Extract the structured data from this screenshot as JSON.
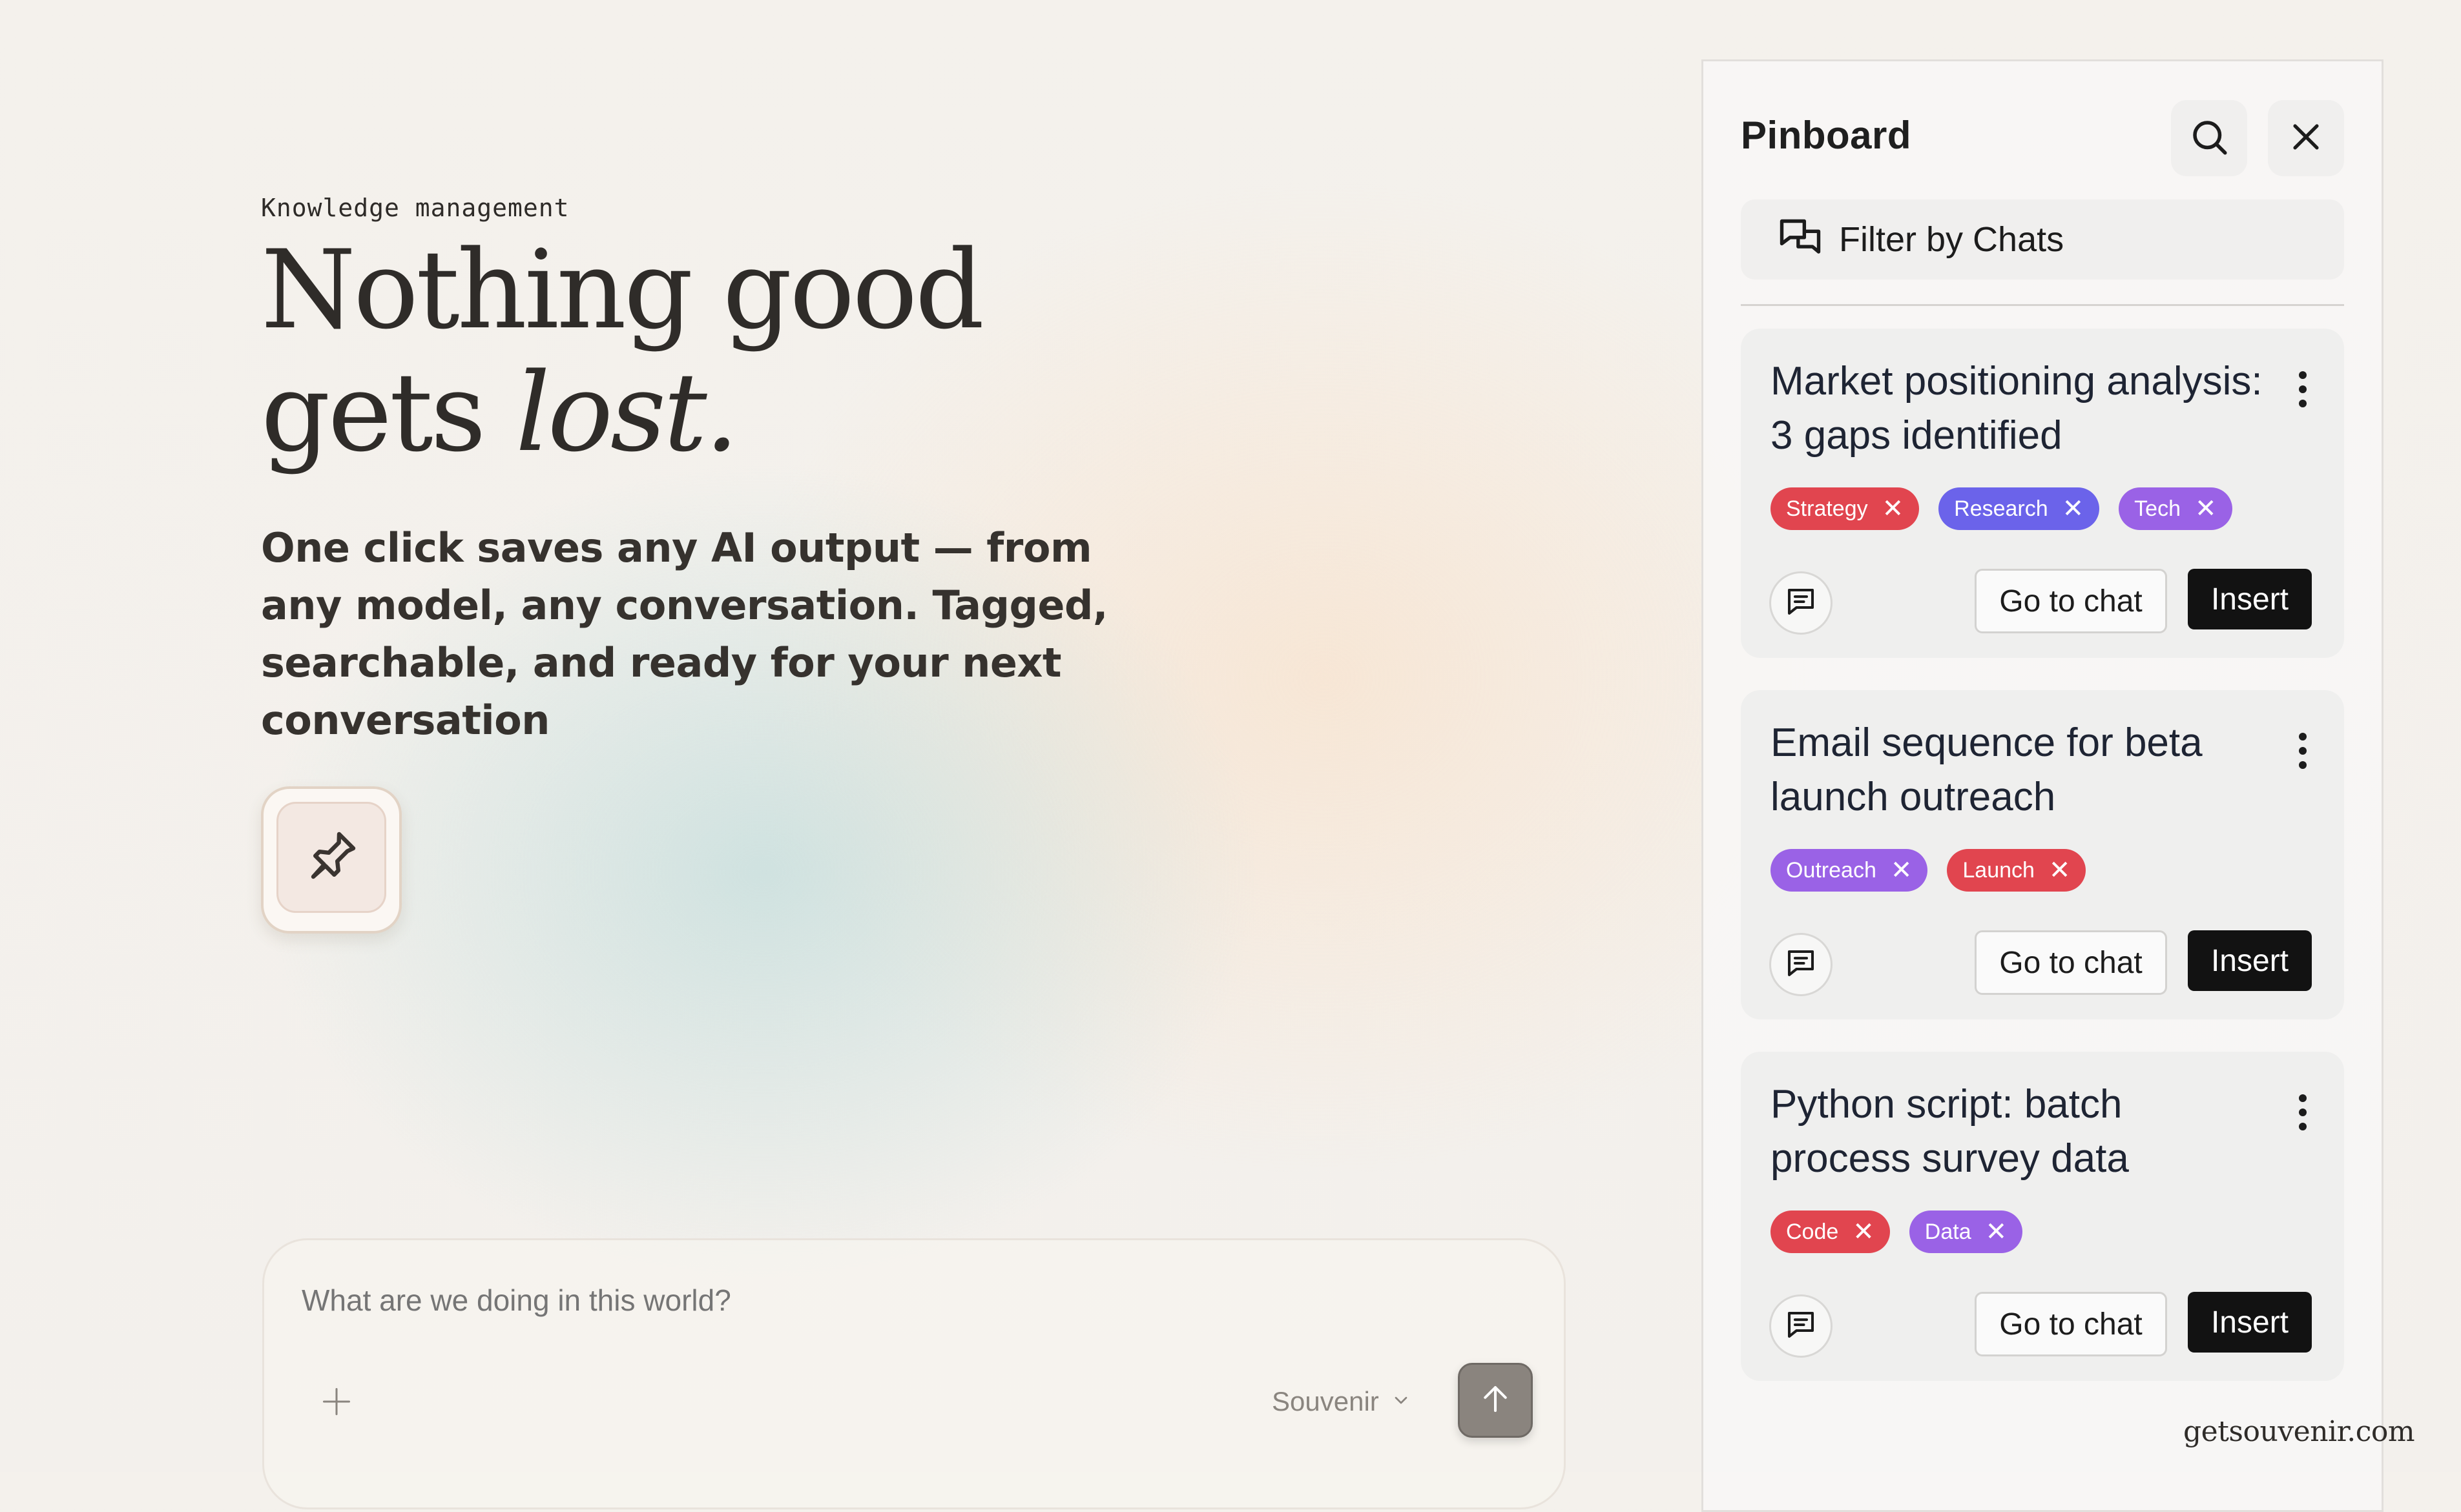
{
  "hero": {
    "eyebrow": "Knowledge management",
    "headline_line1": "Nothing good",
    "headline_line2_pre": "gets ",
    "headline_line2_italic": "lost.",
    "subtext": "One click saves any AI output — from any model, any conversation. Tagged, searchable, and ready for your next conversation",
    "pin_icon": "pushpin-icon"
  },
  "composer": {
    "placeholder": "What are we doing in this world?",
    "add_icon": "plus-icon",
    "model": "Souvenir",
    "model_icon": "chevron-down-icon",
    "send_icon": "arrow-up-icon"
  },
  "pinboard": {
    "title": "Pinboard",
    "search_icon": "search-icon",
    "close_icon": "close-icon",
    "filter_label": "Filter by Chats",
    "filter_icon": "chat-bubbles-icon",
    "cards": [
      {
        "title_line1": "Market positioning analysis:",
        "title_line2": "3 gaps identified",
        "tags": [
          {
            "label": "Strategy",
            "color": "#e1454f"
          },
          {
            "label": "Research",
            "color": "#6b63ea"
          },
          {
            "label": "Tech",
            "color": "#9a62e6"
          }
        ],
        "go_to_chat": "Go to chat",
        "insert": "Insert"
      },
      {
        "title_line1": "Email sequence for beta",
        "title_line2": "launch outreach",
        "tags": [
          {
            "label": "Outreach",
            "color": "#9a62e6"
          },
          {
            "label": "Launch",
            "color": "#e1454f"
          }
        ],
        "go_to_chat": "Go to chat",
        "insert": "Insert"
      },
      {
        "title_line1": "Python script: batch",
        "title_line2": "process survey data",
        "tags": [
          {
            "label": "Code",
            "color": "#e1454f"
          },
          {
            "label": "Data",
            "color": "#9a62e6"
          }
        ],
        "go_to_chat": "Go to chat",
        "insert": "Insert"
      }
    ]
  },
  "footer": {
    "brand": "getsouvenir.com"
  }
}
